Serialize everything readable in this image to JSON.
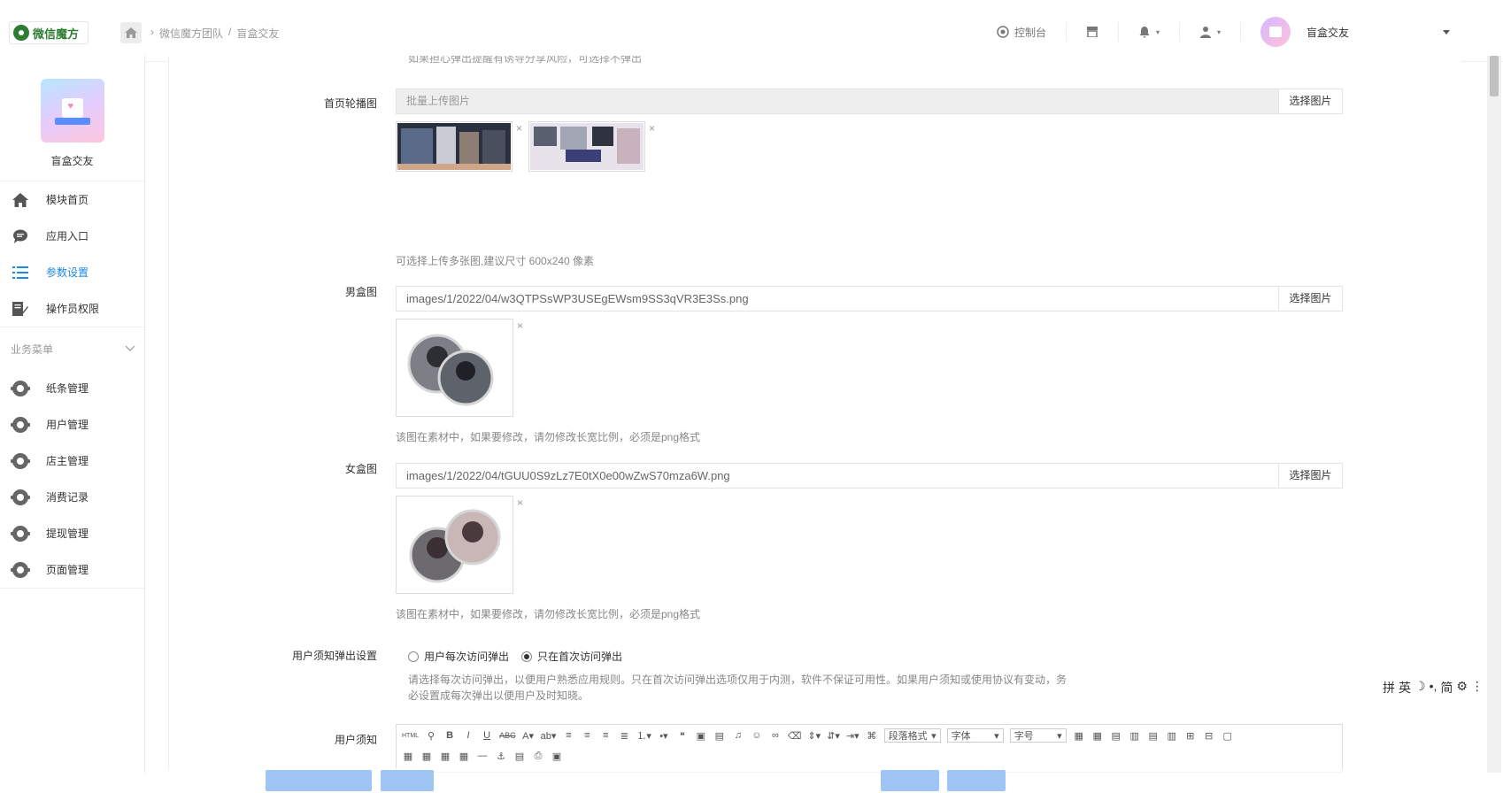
{
  "header": {
    "logo_text": "微信魔方",
    "breadcrumb": [
      "微信魔方团队",
      "/",
      "盲盒交友"
    ],
    "console_label": "控制台",
    "username": "盲盒交友"
  },
  "sidebar": {
    "app_name": "盲盒交友",
    "items": [
      {
        "label": "模块首页",
        "icon": "home-icon"
      },
      {
        "label": "应用入口",
        "icon": "chat-icon"
      },
      {
        "label": "参数设置",
        "icon": "list-icon",
        "active": true
      },
      {
        "label": "操作员权限",
        "icon": "edit-icon"
      }
    ],
    "section_title": "业务菜单",
    "business_items": [
      "纸条管理",
      "用户管理",
      "店主管理",
      "消费记录",
      "提现管理",
      "页面管理"
    ]
  },
  "form": {
    "cut_note": "如果担心弹出提醒有诱导分享风险，可选择不弹出",
    "banner": {
      "label": "首页轮播图",
      "placeholder": "批量上传图片",
      "button": "选择图片",
      "hint": "可选择上传多张图,建议尺寸 600x240 像素"
    },
    "male_box": {
      "label": "男盒图",
      "value": "images/1/2022/04/w3QTPSsWP3USEgEWsm9SS3qVR3E3Ss.png",
      "button": "选择图片",
      "hint": "该图在素材中，如果要修改，请勿修改长宽比例，必须是png格式"
    },
    "female_box": {
      "label": "女盒图",
      "value": "images/1/2022/04/tGUU0S9zLz7E0tX0e00wZwS70mza6W.png",
      "button": "选择图片",
      "hint": "该图在素材中，如果要修改，请勿修改长宽比例，必须是png格式"
    },
    "popup": {
      "label": "用户须知弹出设置",
      "option1": "用户每次访问弹出",
      "option2": "只在首次访问弹出",
      "hint_line1": "请选择每次访问弹出，以便用户熟悉应用规则。只在首次访问弹出选项仅用于内测，软件不保证可用性。如果用户须知或使用协议有变动，务",
      "hint_line2": "必设置成每次弹出以便用户及时知晓。"
    },
    "notice": {
      "label": "用户须知",
      "toolbar": {
        "html": "HTML",
        "paragraph": "段落格式",
        "font": "字体",
        "size": "字号"
      }
    },
    "remove_mark": "×"
  },
  "ime": {
    "chars": [
      "拼",
      "英",
      "简"
    ]
  }
}
